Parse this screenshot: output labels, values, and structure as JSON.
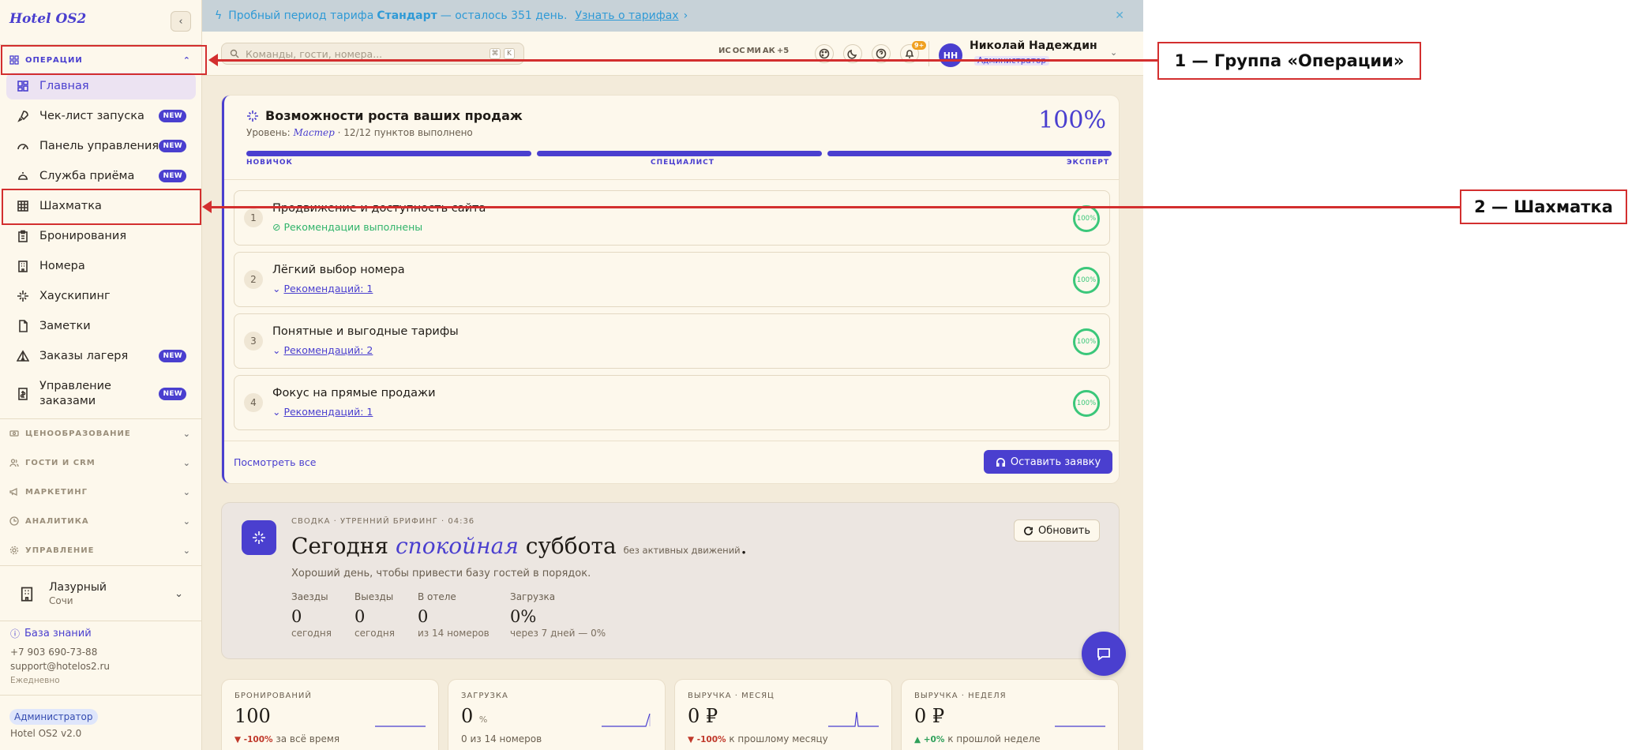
{
  "app": {
    "brand": "Hotel OS2"
  },
  "banner": {
    "text_pre": "Пробный период тарифа",
    "plan": "Стандарт",
    "text_post": "— осталось 351 день.",
    "link": "Узнать о тарифах",
    "link_arrow": "›"
  },
  "sidebar": {
    "operations_group": "ОПЕРАЦИИ",
    "items": [
      {
        "label": "Главная"
      },
      {
        "label": "Чек-лист запуска",
        "badge": "NEW"
      },
      {
        "label": "Панель управления",
        "badge": "NEW"
      },
      {
        "label": "Служба приёма",
        "badge": "NEW"
      },
      {
        "label": "Шахматка"
      },
      {
        "label": "Бронирования"
      },
      {
        "label": "Номера"
      },
      {
        "label": "Хаускипинг"
      },
      {
        "label": "Заметки"
      },
      {
        "label": "Заказы лагеря",
        "badge": "NEW"
      },
      {
        "label": "Управление заказами",
        "badge": "NEW"
      }
    ],
    "groups": [
      "ЦЕНООБРАЗОВАНИЕ",
      "ГОСТИ И CRM",
      "МАРКЕТИНГ",
      "АНАЛИТИКА",
      "УПРАВЛЕНИЕ"
    ],
    "hotel": {
      "name": "Лазурный",
      "city": "Сочи"
    },
    "footer": {
      "kb": "База знаний",
      "phone": "+7 903 690-73-88",
      "email": "support@hotelos2.ru",
      "schedule": "Ежедневно",
      "role": "Администратор",
      "version": "Hotel OS2 v2.0"
    }
  },
  "topbar": {
    "search_placeholder": "Команды, гости, номера...",
    "search_keys": [
      "⌘",
      "K"
    ],
    "avatars": [
      "ИС",
      "ОС",
      "МИ",
      "АК",
      "+5"
    ],
    "notif_count": "9+",
    "user_initials": "НН",
    "user_name": "Николай Надеждин",
    "user_role": "Администратор"
  },
  "growth": {
    "title": "Возможности роста ваших продаж",
    "level_label": "Уровень:",
    "level": "Мастер",
    "progress_text": "· 12/12 пунктов выполнено",
    "percent": "100%",
    "levels": [
      "НОВИЧОК",
      "СПЕЦИАЛИСТ",
      "ЭКСПЕРТ"
    ],
    "items": [
      {
        "num": "1",
        "title": "Продвижение и доступность сайта",
        "sub": "Рекомендации выполнены",
        "done": true,
        "pct": "100%"
      },
      {
        "num": "2",
        "title": "Лёгкий выбор номера",
        "sub": "Рекомендаций: 1",
        "pct": "100%"
      },
      {
        "num": "3",
        "title": "Понятные и выгодные тарифы",
        "sub": "Рекомендаций: 2",
        "pct": "100%"
      },
      {
        "num": "4",
        "title": "Фокус на прямые продажи",
        "sub": "Рекомендаций: 1",
        "pct": "100%"
      }
    ],
    "view_all": "Посмотреть все",
    "apply": "Оставить заявку"
  },
  "briefing": {
    "kicker": "СВОДКА · УТРЕННИЙ БРИФИНГ · 04:36",
    "h_pre": "Сегодня",
    "h_em": "спокойная",
    "h_post": "суббота",
    "h_small": "без активных движений",
    "h_dot": ".",
    "desc": "Хороший день, чтобы привести базу гостей в порядок.",
    "refresh": "Обновить",
    "stats": [
      {
        "label": "Заезды",
        "value": "0",
        "sub": "сегодня"
      },
      {
        "label": "Выезды",
        "value": "0",
        "sub": "сегодня"
      },
      {
        "label": "В отеле",
        "value": "0",
        "sub": "из 14 номеров"
      },
      {
        "label": "Загрузка",
        "value": "0%",
        "sub": "через 7 дней — 0%"
      }
    ]
  },
  "kpis": [
    {
      "label": "БРОНИРОВАНИЙ",
      "value": "100",
      "unit": "",
      "delta": "▼ -100%",
      "foot": "за всё время"
    },
    {
      "label": "ЗАГРУЗКА",
      "value": "0",
      "unit": "%",
      "delta": "",
      "foot": "0 из 14 номеров"
    },
    {
      "label": "ВЫРУЧКА · МЕСЯЦ",
      "value": "0 ₽",
      "unit": "",
      "delta": "▼ -100%",
      "foot": "к прошлому месяцу"
    },
    {
      "label": "ВЫРУЧКА · НЕДЕЛЯ",
      "value": "0 ₽",
      "unit": "",
      "delta": "▲ +0%",
      "foot": "к прошлой неделе"
    }
  ],
  "annotations": {
    "callout1": "1 — Группа «Операции»",
    "callout2": "2 — Шахматка"
  },
  "colors": {
    "accent": "#4a3fcf",
    "annotation": "#d32f2f",
    "success": "#3bc77a"
  }
}
